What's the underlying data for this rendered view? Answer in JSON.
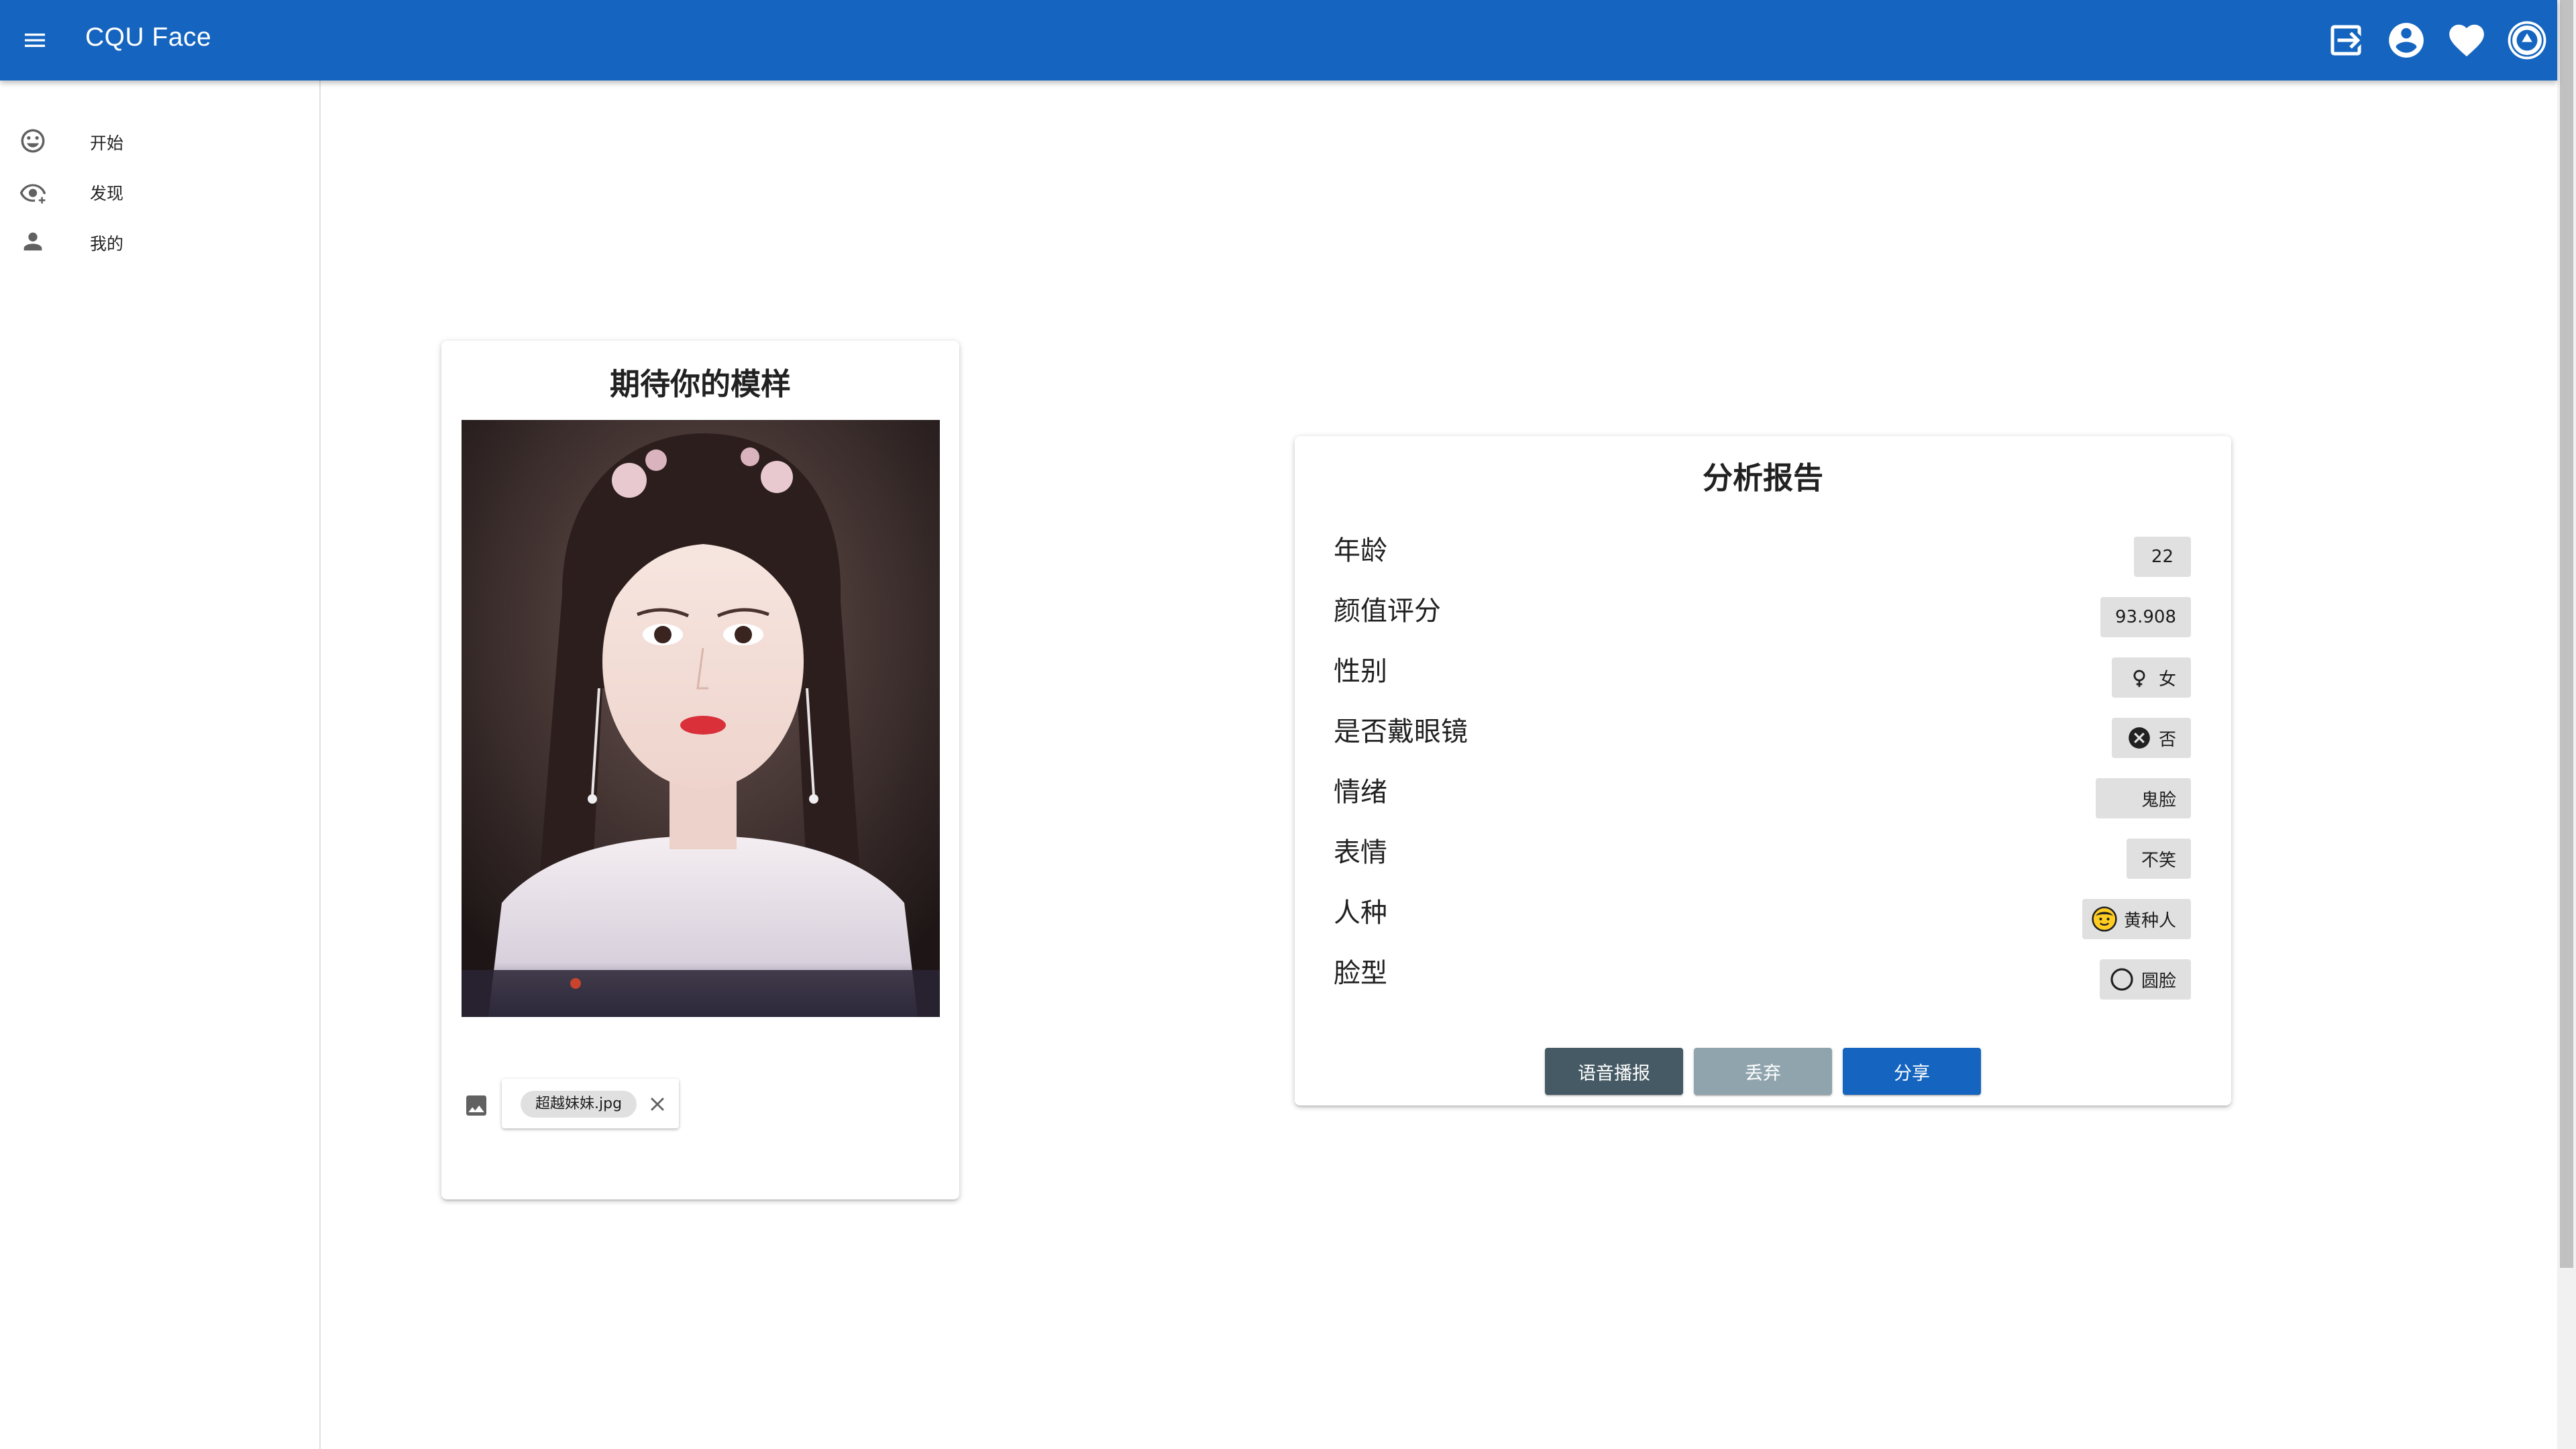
{
  "appbar": {
    "title": "CQU Face",
    "icons": [
      "logout-icon",
      "account-circle-icon",
      "heart-icon",
      "university-logo"
    ]
  },
  "sidebar": {
    "items": [
      {
        "label": "开始",
        "icon": "smile-icon"
      },
      {
        "label": "发现",
        "icon": "eye-plus-icon"
      },
      {
        "label": "我的",
        "icon": "person-icon"
      }
    ]
  },
  "upload": {
    "title": "期待你的模样",
    "file_name": "超越妹妹.jpg"
  },
  "report": {
    "title": "分析报告",
    "rows": [
      {
        "label": "年龄",
        "value": "22",
        "icon": ""
      },
      {
        "label": "颜值评分",
        "value": "93.908",
        "icon": ""
      },
      {
        "label": "性别",
        "value": "女",
        "icon": "female-icon"
      },
      {
        "label": "是否戴眼镜",
        "value": "否",
        "icon": "close-circle-icon"
      },
      {
        "label": "情绪",
        "value": "鬼脸",
        "icon": ""
      },
      {
        "label": "表情",
        "value": "不笑",
        "icon": ""
      },
      {
        "label": "人种",
        "value": "黄种人",
        "icon": "emoji-face-icon"
      },
      {
        "label": "脸型",
        "value": "圆脸",
        "icon": "circle-outline-icon"
      }
    ],
    "buttons": {
      "voice": "语音播报",
      "discard": "丢弃",
      "share": "分享"
    }
  },
  "colors": {
    "appbar": "#1565c0",
    "voice_button": "#455a64",
    "discard_button": "#90a4ae",
    "share_button": "#1565c0"
  }
}
